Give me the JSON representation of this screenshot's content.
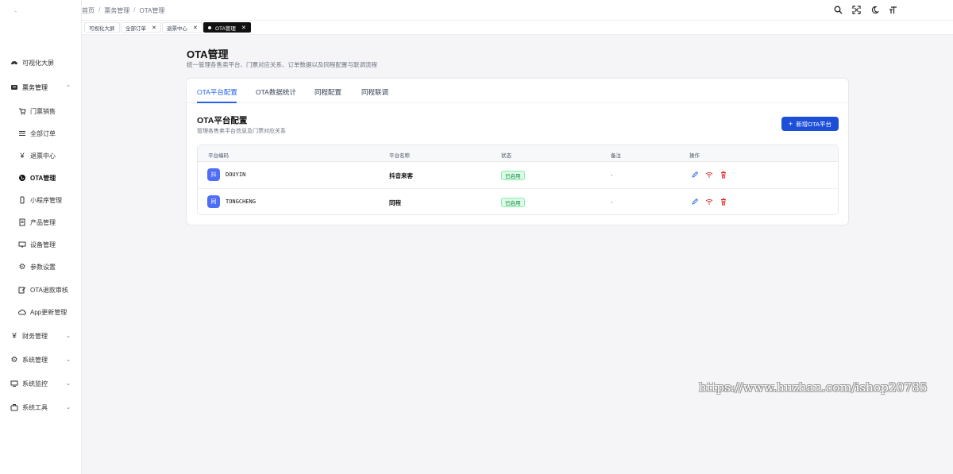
{
  "breadcrumb": [
    "首页",
    "票务管理",
    "OTA管理"
  ],
  "page_tabs": [
    {
      "label": "可视化大屏",
      "closable": false
    },
    {
      "label": "全部订单",
      "closable": true
    },
    {
      "label": "退票中心",
      "closable": true
    },
    {
      "label": "OTA管理",
      "closable": true,
      "active": true
    }
  ],
  "sidebar": {
    "items": [
      {
        "label": "可视化大屏",
        "icon": "dashboard-icon"
      },
      {
        "label": "票务管理",
        "icon": "ticket-icon",
        "expanded": true
      },
      {
        "label": "门票销售",
        "icon": "cart-icon"
      },
      {
        "label": "全部订单",
        "icon": "list-icon"
      },
      {
        "label": "退票中心",
        "icon": "refund-icon"
      },
      {
        "label": "OTA管理",
        "icon": "globe-icon",
        "active": true
      },
      {
        "label": "小程序管理",
        "icon": "mobile-icon"
      },
      {
        "label": "产品管理",
        "icon": "product-icon"
      },
      {
        "label": "设备管理",
        "icon": "device-icon"
      },
      {
        "label": "参数设置",
        "icon": "gear-icon"
      },
      {
        "label": "OTA退款审核",
        "icon": "edit-icon"
      },
      {
        "label": "App更新管理",
        "icon": "cloud-icon"
      },
      {
        "label": "财务管理",
        "icon": "yen-icon"
      },
      {
        "label": "系统管理",
        "icon": "gear-icon"
      },
      {
        "label": "系统监控",
        "icon": "monitor-icon"
      },
      {
        "label": "系统工具",
        "icon": "toolbox-icon"
      }
    ]
  },
  "main": {
    "title": "OTA管理",
    "subtitle": "统一管理各售卖平台、门票对应关系、订单数据以及同程配置与联调流程",
    "tabs": [
      "OTA平台配置",
      "OTA数据统计",
      "同程配置",
      "同程联调"
    ],
    "section_title": "OTA平台配置",
    "section_subtitle": "管理各售卖平台信息及门票对应关系",
    "add_button": "新增OTA平台",
    "table": {
      "headers": [
        "平台编码",
        "平台名称",
        "状态",
        "备注",
        "操作"
      ],
      "rows": [
        {
          "badge": "抖",
          "code": "DOUYIN",
          "name": "抖音来客",
          "status": "已启用",
          "note": "-"
        },
        {
          "badge": "同",
          "code": "TONGCHENG",
          "name": "同程",
          "status": "已启用",
          "note": "-"
        }
      ]
    }
  },
  "watermark": "https://www.huzhan.com/ishop20785",
  "colors": {
    "accent": "#2563eb",
    "status_green": "#15803d",
    "danger": "#dc2626"
  }
}
